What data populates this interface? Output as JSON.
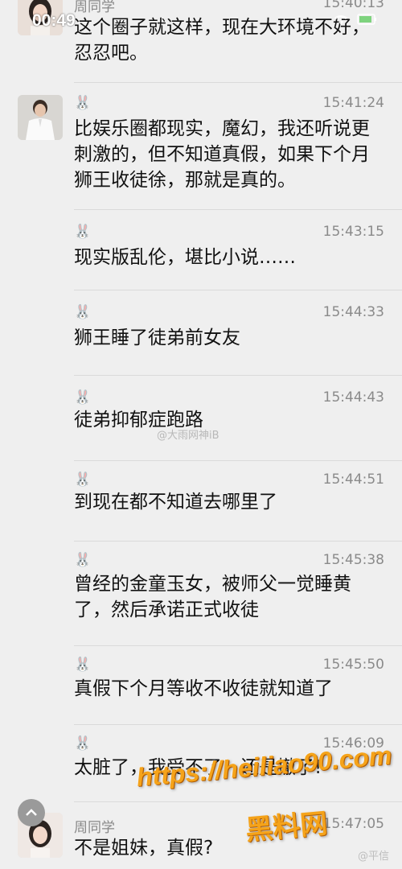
{
  "status_bar": {
    "time": "00:49"
  },
  "messages": [
    {
      "sender": "周同学",
      "time": "15:40:13",
      "text": "这个圈子就这样，现在大环境不好，忍忍吧。",
      "avatar": "female"
    },
    {
      "sender": "🐰",
      "time": "15:41:24",
      "text": "比娱乐圈都现实，魔幻，我还听说更刺激的，但不知道真假，如果下个月狮王收徒徐，那就是真的。",
      "avatar": "male"
    },
    {
      "sender": "🐰",
      "time": "15:43:15",
      "text": "现实版乱伦，堪比小说……"
    },
    {
      "sender": "🐰",
      "time": "15:44:33",
      "text": "狮王睡了徒弟前女友"
    },
    {
      "sender": "🐰",
      "time": "15:44:43",
      "text": "徒弟抑郁症跑路"
    },
    {
      "sender": "🐰",
      "time": "15:44:51",
      "text": "到现在都不知道去哪里了"
    },
    {
      "sender": "🐰",
      "time": "15:45:38",
      "text": "曾经的金童玉女，被师父一觉睡黄了，然后承诺正式收徒"
    },
    {
      "sender": "🐰",
      "time": "15:45:50",
      "text": "真假下个月等收不收徒就知道了"
    },
    {
      "sender": "🐰",
      "time": "15:46:09",
      "text": "太脏了，我受不了，还是撤了!"
    },
    {
      "sender": "周同学",
      "time": "15:47:05",
      "text": "不是姐妹，真假?",
      "avatar": "female"
    }
  ],
  "watermarks": {
    "center": "@大雨网神iB",
    "brand_url": "https://heiliao90.com",
    "brand_name": "黑料网",
    "corner": "@平信"
  },
  "colors": {
    "background": "#efefef",
    "watermark_orange": "#f5a31a"
  },
  "icons": [
    "scroll-up-icon",
    "bunny-icon",
    "wifi-icon",
    "battery-icon"
  ]
}
